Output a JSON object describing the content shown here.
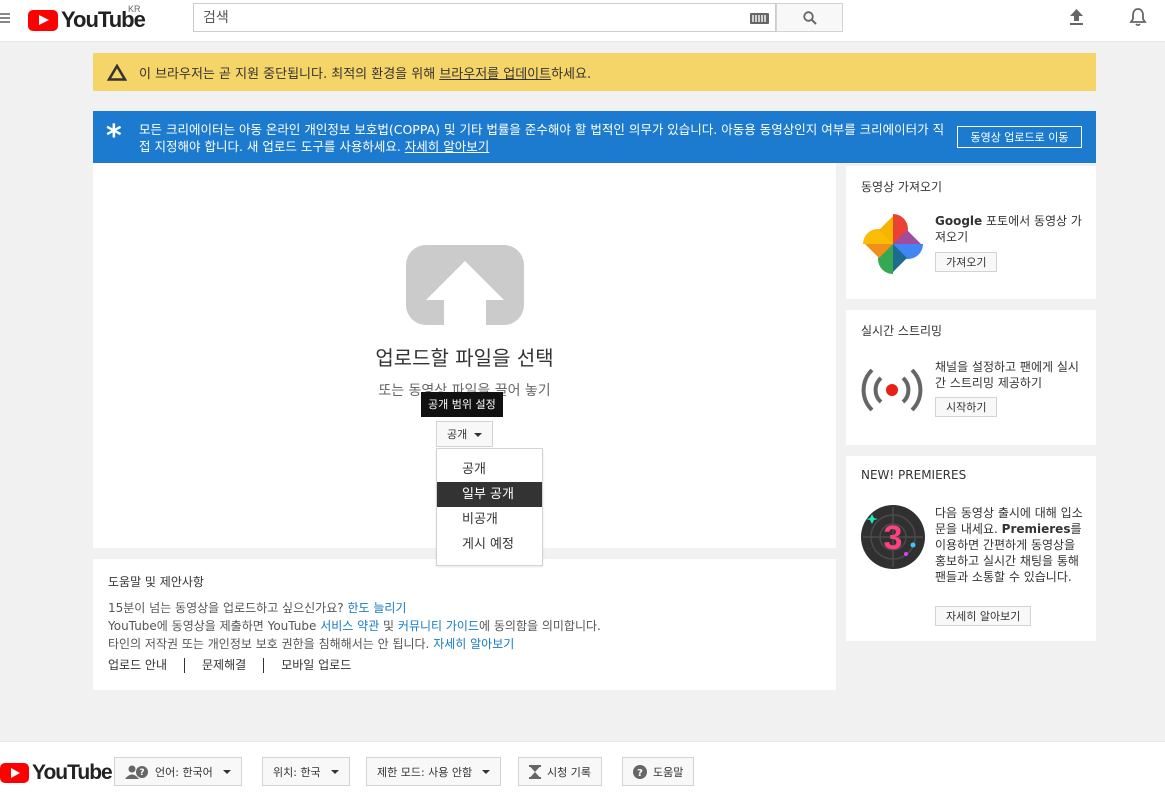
{
  "header": {
    "logo_text": "YouTube",
    "country": "KR",
    "search": {
      "placeholder": "검색"
    }
  },
  "warning_banner": {
    "text_before": "이 브라우저는 곧 지원 중단됩니다. 최적의 환경을 위해 ",
    "link": "브라우저를 업데이트",
    "text_after": "하세요."
  },
  "coppa_banner": {
    "icon": "*",
    "text": "모든 크리에이터는 아동 온라인 개인정보 보호법(COPPA) 및 기타 법률을 준수해야 할 법적인 의무가 있습니다. 아동용 동영상인지 여부를 크리에이터가 직접 지정해야 합니다. 새 업로드 도구를 사용하세요. ",
    "link": "자세히 알아보기",
    "button": "동영상 업로드로 이동"
  },
  "upload": {
    "title": "업로드할 파일을 선택",
    "subtitle": "또는 동영상 파일을 끌어 놓기",
    "privacy_button": "공개",
    "tooltip": "공개 범위 설정",
    "options": [
      "공개",
      "일부 공개",
      "비공개",
      "게시 예정"
    ],
    "selected_index": 1
  },
  "help": {
    "title": "도움말 및 제안사항",
    "line1_text": "15분이 넘는 동영상을 업로드하고 싶으신가요? ",
    "line1_link": "한도 늘리기",
    "line2_a": "YouTube에 동영상을 제출하면 YouTube ",
    "line2_link1": "서비스 약관",
    "line2_b": " 및 ",
    "line2_link2": "커뮤니티 가이드",
    "line2_c": "에 동의함을 의미합니다.",
    "line3_text": "타인의 저작권 또는 개인정보 보호 권한을 침해해서는 안 됩니다. ",
    "line3_link": "자세히 알아보기",
    "links": [
      "업로드 안내",
      "문제해결",
      "모바일 업로드"
    ]
  },
  "side": {
    "import": {
      "title": "동영상 가져오기",
      "text_bold": "Google",
      "text": " 포토에서 동영상 가져오기",
      "button": "가져오기"
    },
    "live": {
      "title": "실시간 스트리밍",
      "text": "채널을 설정하고 팬에게 실시간 스트리밍 제공하기",
      "button": "시작하기"
    },
    "premieres": {
      "title": "NEW! PREMIERES",
      "text1": "다음 동영상 출시에 대해 입소문을 내세요. ",
      "text_bold": "Premieres",
      "text2": "를 이용하면 간편하게 동영상을 홍보하고 실시간 채팅을 통해 팬들과 소통할 수 있습니다.",
      "icon_number": "3",
      "button": "자세히 알아보기"
    }
  },
  "footer": {
    "logo_text": "YouTube",
    "language": "언어: 한국어",
    "location": "위치: 한국",
    "restricted": "제한 모드: 사용 안함",
    "history": "시청 기록",
    "help": "도움말"
  },
  "colors": {
    "brand_red": "#ff0000",
    "warning_bg": "#f5d468",
    "coppa_bg": "#1c7bce",
    "link_blue": "#167ac6"
  },
  "icons": [
    "menu-icon",
    "youtube-logo",
    "keyboard-icon",
    "search-icon",
    "upload-icon",
    "bell-icon",
    "warning-icon",
    "upload-arrow-icon",
    "google-photos-icon",
    "live-stream-icon",
    "premieres-icon",
    "user-question-icon",
    "hourglass-icon",
    "help-icon"
  ]
}
